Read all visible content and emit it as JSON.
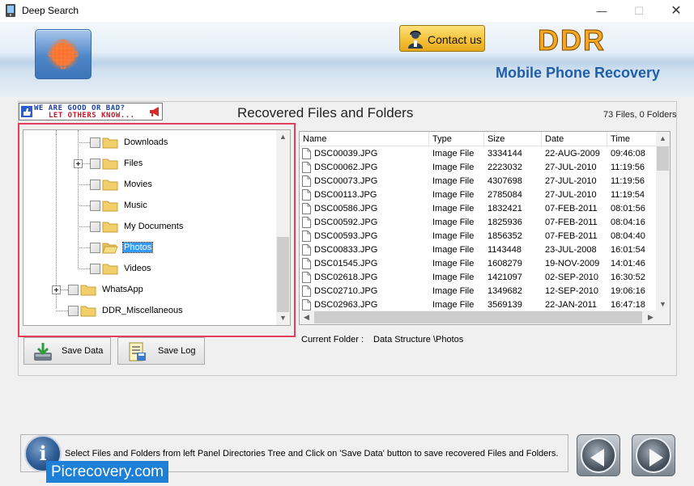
{
  "window": {
    "title": "Deep Search",
    "minimize_glyph": "—",
    "maximize_glyph": "☐",
    "close_glyph": "✕"
  },
  "header": {
    "contact_label": "Contact us",
    "brand": "DDR",
    "product": "Mobile Phone Recovery"
  },
  "feedback": {
    "line1": "WE ARE GOOD OR BAD?",
    "line2": "LET OTHERS KNOW..."
  },
  "section_title": "Recovered Files and Folders",
  "count": "73 Files, 0 Folders",
  "tree": {
    "items": [
      {
        "label": "Downloads",
        "level": 3,
        "expandable": false,
        "selected": false
      },
      {
        "label": "Files",
        "level": 3,
        "expandable": true,
        "selected": false
      },
      {
        "label": "Movies",
        "level": 3,
        "expandable": false,
        "selected": false
      },
      {
        "label": "Music",
        "level": 3,
        "expandable": false,
        "selected": false
      },
      {
        "label": "My Documents",
        "level": 3,
        "expandable": false,
        "selected": false
      },
      {
        "label": "Photos",
        "level": 3,
        "expandable": false,
        "selected": true,
        "open": true
      },
      {
        "label": "Videos",
        "level": 3,
        "expandable": false,
        "selected": false
      },
      {
        "label": "WhatsApp",
        "level": 2,
        "expandable": true,
        "selected": false
      },
      {
        "label": "DDR_Miscellaneous",
        "level": 2,
        "expandable": false,
        "selected": false
      }
    ]
  },
  "buttons": {
    "save_data": "Save Data",
    "save_log": "Save Log"
  },
  "filelist": {
    "columns": [
      "Name",
      "Type",
      "Size",
      "Date",
      "Time"
    ],
    "rows": [
      [
        "DSC00039.JPG",
        "Image File",
        "3334144",
        "22-AUG-2009",
        "09:46:08"
      ],
      [
        "DSC00062.JPG",
        "Image File",
        "2223032",
        "27-JUL-2010",
        "11:19:56"
      ],
      [
        "DSC00073.JPG",
        "Image File",
        "4307698",
        "27-JUL-2010",
        "11:19:56"
      ],
      [
        "DSC00113.JPG",
        "Image File",
        "2785084",
        "27-JUL-2010",
        "11:19:54"
      ],
      [
        "DSC00586.JPG",
        "Image File",
        "1832421",
        "07-FEB-2011",
        "08:01:56"
      ],
      [
        "DSC00592.JPG",
        "Image File",
        "1825936",
        "07-FEB-2011",
        "08:04:16"
      ],
      [
        "DSC00593.JPG",
        "Image File",
        "1856352",
        "07-FEB-2011",
        "08:04:40"
      ],
      [
        "DSC00833.JPG",
        "Image File",
        "1143448",
        "23-JUL-2008",
        "16:01:54"
      ],
      [
        "DSC01545.JPG",
        "Image File",
        "1608279",
        "19-NOV-2009",
        "14:01:46"
      ],
      [
        "DSC02618.JPG",
        "Image File",
        "1421097",
        "02-SEP-2010",
        "16:30:52"
      ],
      [
        "DSC02710.JPG",
        "Image File",
        "1349682",
        "12-SEP-2010",
        "19:06:16"
      ],
      [
        "DSC02963.JPG",
        "Image File",
        "3569139",
        "22-JAN-2011",
        "16:47:18"
      ]
    ]
  },
  "current_folder": {
    "label": "Current Folder :",
    "value": "Data Structure \\Photos"
  },
  "status": {
    "message": "Select Files and Folders from left Panel Directories Tree and Click on 'Save Data' button to save recovered Files and Folders.",
    "info_glyph": "i"
  },
  "watermark": "Picrecovery.com",
  "colors": {
    "accent_blue": "#1f5faa",
    "brand_orange": "#f5a623",
    "highlight_red": "#e0405a",
    "selection": "#3399ff"
  }
}
